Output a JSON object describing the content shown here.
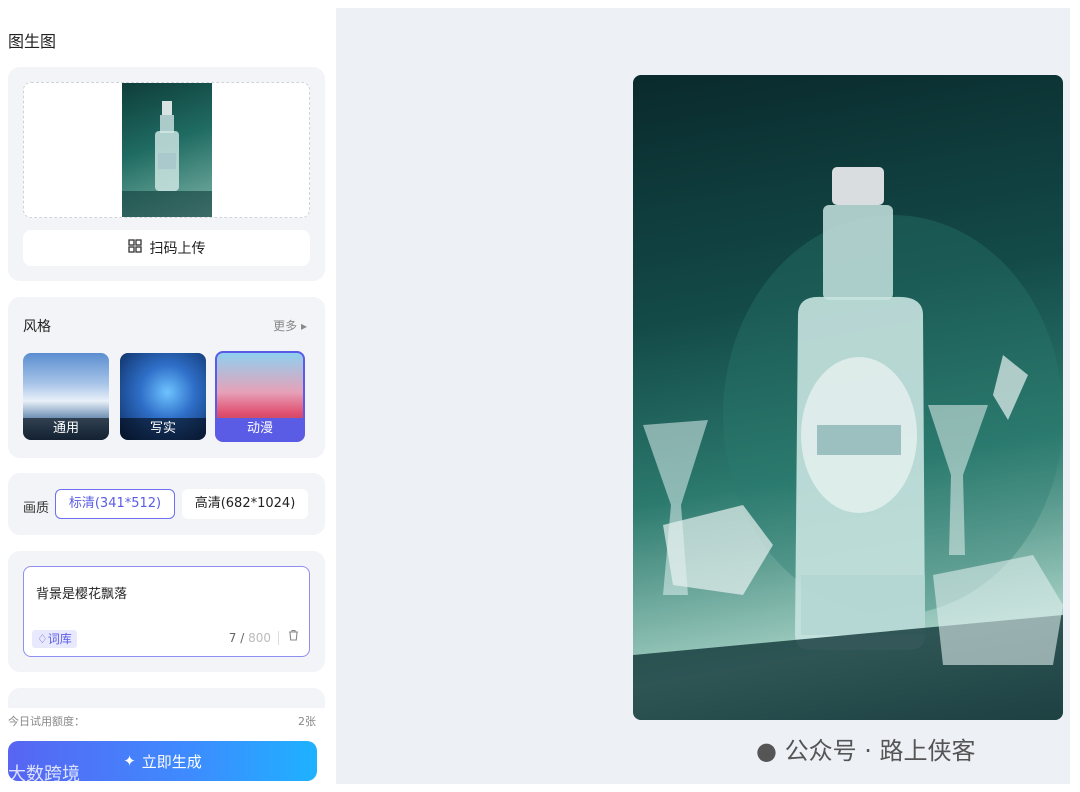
{
  "page": {
    "title": "图生图"
  },
  "upload": {
    "scan_label": "扫码上传"
  },
  "style": {
    "label": "风格",
    "more_label": "更多",
    "options": [
      {
        "label": "通用"
      },
      {
        "label": "写实"
      },
      {
        "label": "动漫",
        "selected": true
      }
    ]
  },
  "quality": {
    "label": "画质",
    "options": [
      {
        "label": "标清(341*512)",
        "selected": true
      },
      {
        "label": "高清(682*1024)"
      }
    ]
  },
  "prompt": {
    "value": "背景是樱花飘落",
    "lexicon_label": "词库",
    "count": "7",
    "max": "800"
  },
  "quota": {
    "label": "今日试用额度：",
    "value": "2张"
  },
  "generate": {
    "label": "立即生成"
  },
  "watermarks": {
    "left": "大数跨境",
    "right": "公众号 · 路上侠客"
  },
  "colors": {
    "accent": "#5b5ce6",
    "panel": "#f3f4f7",
    "canvas": "#edf0f5"
  }
}
